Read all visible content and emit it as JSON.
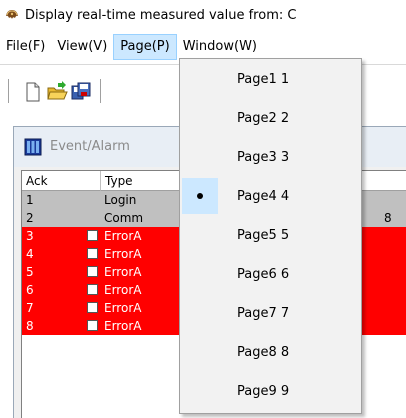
{
  "title": "Display real-time measured value from: C",
  "menubar": [
    {
      "label": "File(F)"
    },
    {
      "label": "View(V)"
    },
    {
      "label": "Page(P)"
    },
    {
      "label": "Window(W)"
    }
  ],
  "child_window": {
    "title": "Event/Alarm",
    "columns": [
      "Ack",
      "Type"
    ],
    "rows": [
      {
        "ack": "1",
        "type": "Login",
        "style": "gray"
      },
      {
        "ack": "2",
        "type": "Comm",
        "style": "gray",
        "extra": "8"
      },
      {
        "ack": "3",
        "type": "ErrorA",
        "style": "red"
      },
      {
        "ack": "4",
        "type": "ErrorA",
        "style": "red"
      },
      {
        "ack": "5",
        "type": "ErrorA",
        "style": "red"
      },
      {
        "ack": "6",
        "type": "ErrorA",
        "style": "red"
      },
      {
        "ack": "7",
        "type": "ErrorA",
        "style": "red"
      },
      {
        "ack": "8",
        "type": "ErrorA",
        "style": "red"
      }
    ]
  },
  "page_menu": {
    "items": [
      {
        "label": "Page1 1",
        "checked": false
      },
      {
        "label": "Page2 2",
        "checked": false
      },
      {
        "label": "Page3 3",
        "checked": false
      },
      {
        "label": "Page4 4",
        "checked": true
      },
      {
        "label": "Page5 5",
        "checked": false
      },
      {
        "label": "Page6 6",
        "checked": false
      },
      {
        "label": "Page7 7",
        "checked": false
      },
      {
        "label": "Page8 8",
        "checked": false
      },
      {
        "label": "Page9 9",
        "checked": false
      }
    ]
  },
  "colors": {
    "highlight": "#cce8ff",
    "error_row": "#ff0000",
    "gray_row": "#c0c0c0"
  },
  "icons": [
    "app-icon",
    "new-file-icon",
    "open-folder-icon",
    "save-icon",
    "window-icon"
  ]
}
